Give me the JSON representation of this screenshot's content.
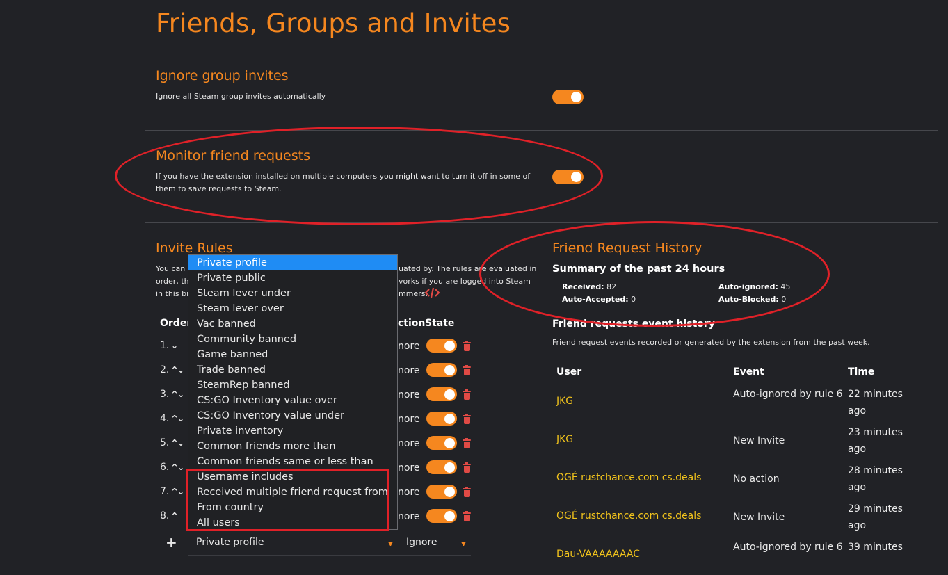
{
  "page": {
    "title": "Friends, Groups and Invites"
  },
  "ignore_group": {
    "title": "Ignore group invites",
    "desc": "Ignore all Steam group invites automatically",
    "enabled": true
  },
  "monitor": {
    "title": "Monitor friend requests",
    "desc_line1": "If you have the extension installed on multiple computers you might want to turn it off in some of",
    "desc_line2": "them to save requests to Steam.",
    "enabled": true
  },
  "invite_rules": {
    "title": "Invite Rules",
    "desc_line1": "You can s",
    "desc_line1b": "uated by. The rules are evaluated in",
    "desc_line2": "order, th",
    "desc_line2b": "vorks if you are logged into Steam",
    "desc_line3": "in this br",
    "desc_line3b": "mmers.",
    "col_order": "Order",
    "col_action": "ction",
    "col_state": "State",
    "rows": [
      {
        "num": "1.",
        "arrows": "⌄",
        "action": "nore",
        "state": true
      },
      {
        "num": "2.",
        "arrows": "^⌄",
        "action": "nore",
        "state": true
      },
      {
        "num": "3.",
        "arrows": "^⌄",
        "action": "nore",
        "state": true
      },
      {
        "num": "4.",
        "arrows": "^⌄",
        "action": "nore",
        "state": true
      },
      {
        "num": "5.",
        "arrows": "^⌄",
        "action": "nore",
        "state": true
      },
      {
        "num": "6.",
        "arrows": "^⌄",
        "action": "nore",
        "state": true
      },
      {
        "num": "7.",
        "arrows": "^⌄",
        "action": "nore",
        "state": true
      },
      {
        "num": "8.",
        "arrows": "^",
        "action": "nore",
        "state": true
      }
    ],
    "new_rule": {
      "add": "+",
      "condition": "Private profile",
      "action": "Ignore"
    }
  },
  "dropdown": {
    "options": [
      "Private profile",
      "Private public",
      "Steam lever under",
      "Steam lever over",
      "Vac banned",
      "Community banned",
      "Game banned",
      "Trade banned",
      "SteamRep banned",
      "CS:GO Inventory value over",
      "CS:GO Inventory value under",
      "Private inventory",
      "Common friends more than",
      "Common friends same or less than",
      "Username includes",
      "Received multiple friend request from",
      "From country",
      "All users"
    ],
    "selected": "Private profile"
  },
  "history": {
    "title": "Friend Request History",
    "summary_title": "Summary of the past 24 hours",
    "received_label": "Received:",
    "received_value": "82",
    "accepted_label": "Auto-Accepted:",
    "accepted_value": "0",
    "ignored_label": "Auto-ignored:",
    "ignored_value": "45",
    "blocked_label": "Auto-Blocked:",
    "blocked_value": "0",
    "events_title": "Friend requests event history",
    "events_desc": "Friend request events recorded or generated by the extension from the past week.",
    "col_user": "User",
    "col_event": "Event",
    "col_time": "Time",
    "rows": [
      {
        "user": "JKG",
        "event": "Auto-ignored by rule 6",
        "time": "22 minutes ago"
      },
      {
        "user": "JKG",
        "event": "New Invite",
        "time": "23 minutes ago"
      },
      {
        "user": "OGÉ rustchance.com cs.deals",
        "event": "No action",
        "time": "28 minutes ago"
      },
      {
        "user": "OGÉ rustchance.com cs.deals",
        "event": "New Invite",
        "time": "29 minutes ago"
      },
      {
        "user": "Dau-VAAAAAAAC",
        "event": "Auto-ignored by rule 6",
        "time": "39 minutes"
      }
    ]
  },
  "colors": {
    "accent": "#f5871f",
    "highlight": "#e02128",
    "link": "#f2c41c",
    "select": "#1f8cf4"
  }
}
